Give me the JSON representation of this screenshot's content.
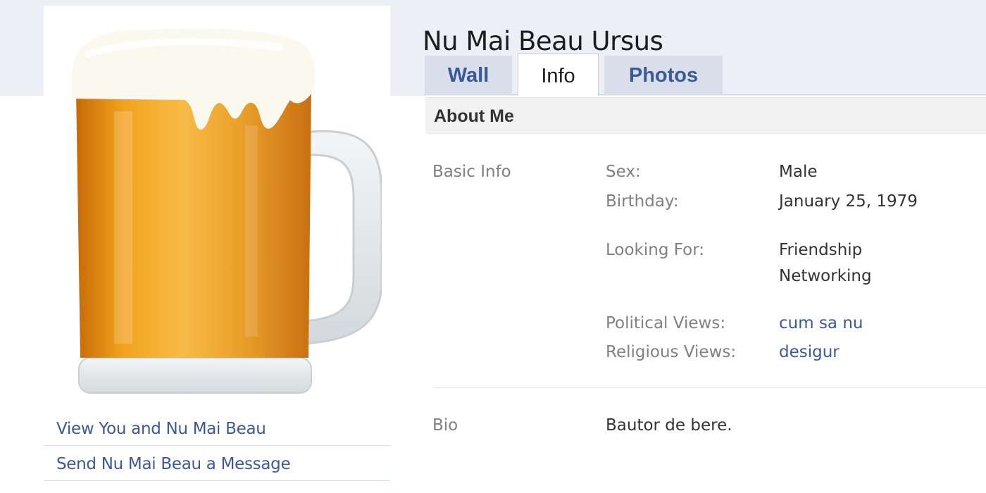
{
  "profile": {
    "name": "Nu Mai Beau Ursus",
    "picture_icon": "beer-mug-image"
  },
  "left_menu": {
    "links": [
      "View You and Nu Mai Beau",
      "Send Nu Mai Beau a Message"
    ]
  },
  "tabs": [
    {
      "label": "Wall",
      "active": false
    },
    {
      "label": "Info",
      "active": true
    },
    {
      "label": "Photos",
      "active": false
    }
  ],
  "about": {
    "title": "About Me",
    "basic_info": {
      "section_label": "Basic Info",
      "sex_label": "Sex:",
      "sex_value": "Male",
      "birthday_label": "Birthday:",
      "birthday_value": "January 25, 1979",
      "looking_for_label": "Looking For:",
      "looking_for_values": [
        "Friendship",
        "Networking"
      ],
      "political_label": "Political Views:",
      "political_value": "cum sa nu",
      "religious_label": "Religious Views:",
      "religious_value": "desigur"
    },
    "bio": {
      "section_label": "Bio",
      "value": "Bautor de bere."
    }
  },
  "colors": {
    "link": "#3b5998",
    "top_band": "#eceff5",
    "tab_inactive": "#d8dfea",
    "beer": "#f0a020",
    "foam": "#fbf8ee"
  }
}
